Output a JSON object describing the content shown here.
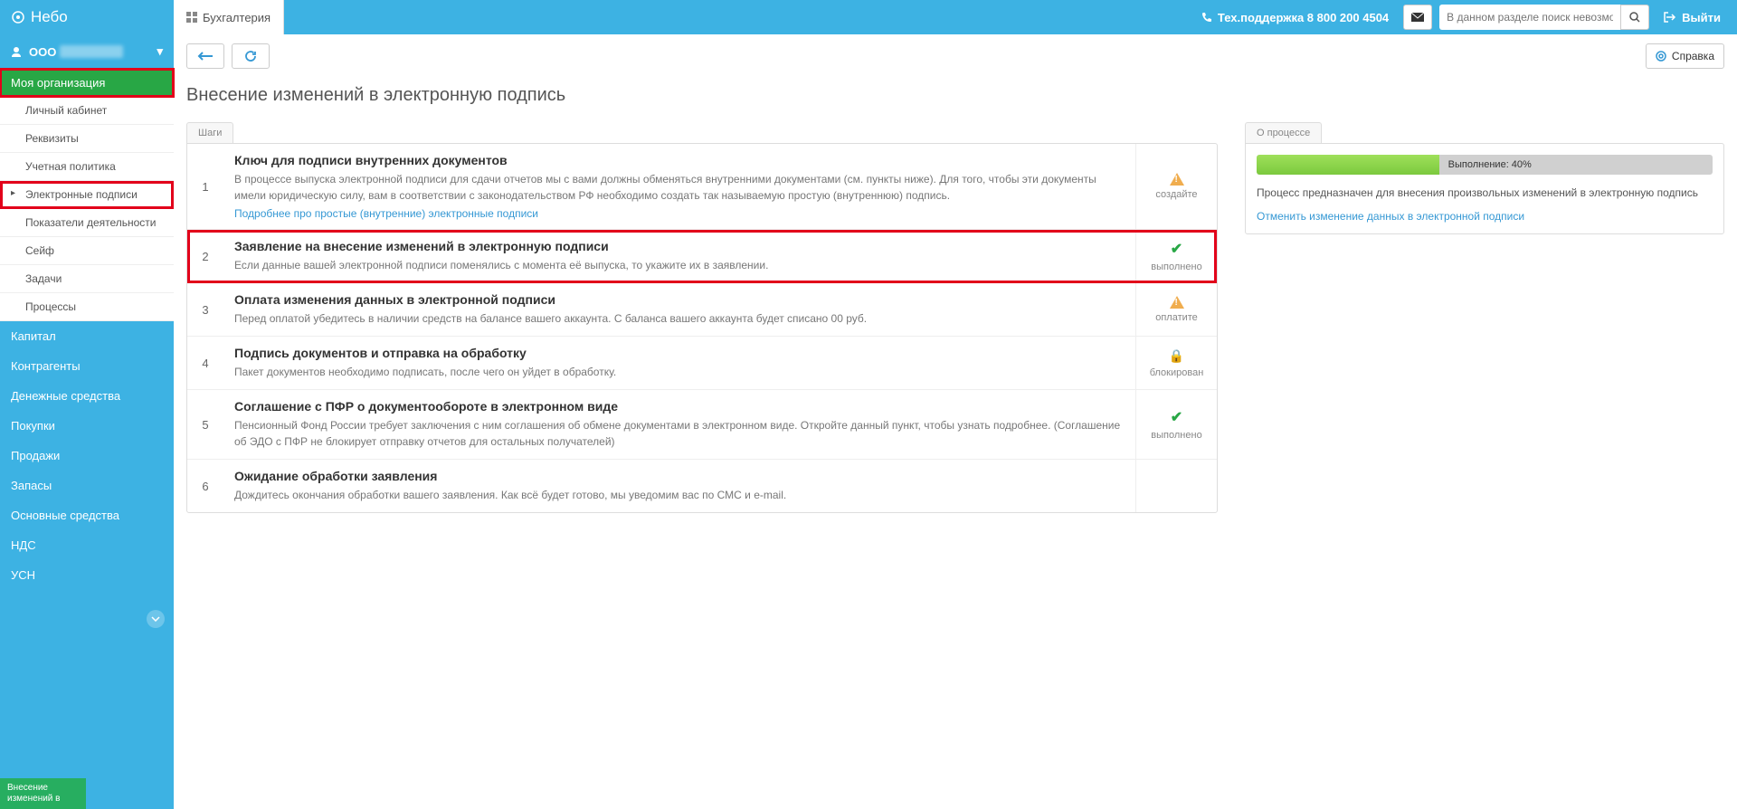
{
  "brand": "Небо",
  "top_tab": "Бухгалтерия",
  "support_label": "Тех.поддержка 8 800 200 4504",
  "search_placeholder": "В данном разделе поиск невозможен",
  "exit_label": "Выйти",
  "org_prefix": "ООО",
  "sidebar": {
    "header": "Моя организация",
    "sub": [
      "Личный кабинет",
      "Реквизиты",
      "Учетная политика",
      "Электронные подписи",
      "Показатели деятельности",
      "Сейф",
      "Задачи",
      "Процессы"
    ],
    "active_sub_index": 3,
    "main": [
      "Капитал",
      "Контрагенты",
      "Денежные средства",
      "Покупки",
      "Продажи",
      "Запасы",
      "Основные средства",
      "НДС",
      "УСН"
    ],
    "tag": "Внесение изменений в"
  },
  "help_button": "Справка",
  "page_title": "Внесение изменений в электронную подпись",
  "steps_tab": "Шаги",
  "steps": [
    {
      "n": "1",
      "title": "Ключ для подписи внутренних документов",
      "desc": "В процессе выпуска электронной подписи для сдачи отчетов мы с вами должны обменяться внутренними документами (см. пункты ниже). Для того, чтобы эти документы имели юридическую силу, вам в соответствии с законодательством РФ необходимо создать так называемую простую (внутреннюю) подпись.",
      "link": "Подробнее про простые (внутренние) электронные подписи",
      "status": "создайте",
      "icon": "warn"
    },
    {
      "n": "2",
      "title": "Заявление на внесение изменений в электронную подписи",
      "desc": "Если данные вашей электронной подписи поменялись с момента её выпуска, то укажите их в заявлении.",
      "link": "",
      "status": "выполнено",
      "icon": "check",
      "hl": true
    },
    {
      "n": "3",
      "title": "Оплата изменения данных в электронной подписи",
      "desc": "Перед оплатой убедитесь в наличии средств на балансе вашего аккаунта. С баланса вашего аккаунта будет списано  00 руб.",
      "link": "",
      "status": "оплатите",
      "icon": "warn"
    },
    {
      "n": "4",
      "title": "Подпись документов и отправка на обработку",
      "desc": "Пакет документов необходимо подписать, после чего он уйдет в обработку.",
      "link": "",
      "status": "блокирован",
      "icon": "lock"
    },
    {
      "n": "5",
      "title": "Соглашение с ПФР о документообороте в электронном виде",
      "desc": "Пенсионный Фонд России требует заключения с ним соглашения об обмене документами в электронном виде. Откройте данный пункт, чтобы узнать подробнее. (Соглашение об ЭДО с ПФР не блокирует отправку отчетов для остальных получателей)",
      "link": "",
      "status": "выполнено",
      "icon": "check"
    },
    {
      "n": "6",
      "title": "Ожидание обработки заявления",
      "desc": "Дождитесь окончания обработки вашего заявления. Как всё будет готово, мы уведомим вас по СМС и e-mail.",
      "link": "",
      "status": "",
      "icon": ""
    }
  ],
  "process_tab": "О процессе",
  "progress_percent": 40,
  "progress_label": "Выполнение: 40%",
  "process_desc": "Процесс предназначен для внесения произвольных изменений в электронную подпись",
  "process_link": "Отменить изменение данных в электронной подписи"
}
